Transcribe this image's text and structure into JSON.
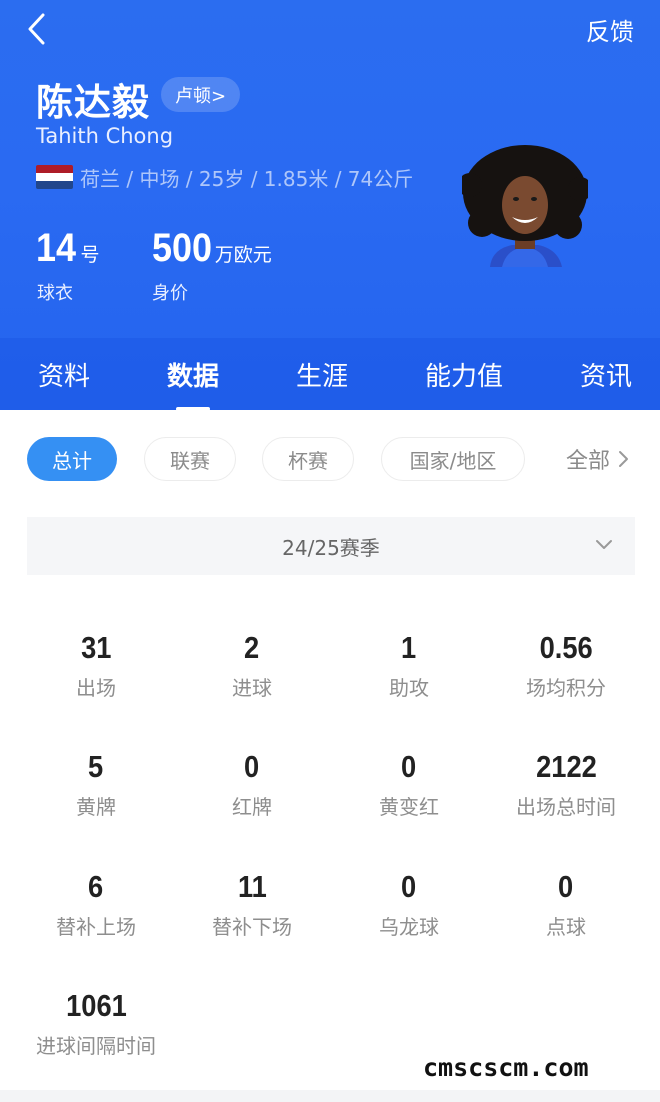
{
  "header": {
    "feedback_label": "反馈",
    "player_name": "陈达毅",
    "club_label": "卢顿>",
    "english_name": "Tahith Chong",
    "info_line": "荷兰 / 中场 / 25岁 / 1.85米 / 74公斤",
    "flag_colors": [
      "#ae1c28",
      "#ffffff",
      "#21468b"
    ],
    "jersey": {
      "value": "14",
      "unit": "号",
      "caption": "球衣"
    },
    "market_value": {
      "value": "500",
      "unit": "万欧元",
      "caption": "身价"
    }
  },
  "tabs": [
    {
      "label": "资料",
      "active": false
    },
    {
      "label": "数据",
      "active": true
    },
    {
      "label": "生涯",
      "active": false
    },
    {
      "label": "能力值",
      "active": false
    },
    {
      "label": "资讯",
      "active": false
    }
  ],
  "filters": {
    "chips": [
      "总计",
      "联赛",
      "杯赛",
      "国家/地区"
    ],
    "selected": "总计",
    "all_label": "全部"
  },
  "season": {
    "selected": "24/25赛季"
  },
  "stats": [
    {
      "value": "31",
      "label": "出场"
    },
    {
      "value": "2",
      "label": "进球"
    },
    {
      "value": "1",
      "label": "助攻"
    },
    {
      "value": "0.56",
      "label": "场均积分"
    },
    {
      "value": "5",
      "label": "黄牌"
    },
    {
      "value": "0",
      "label": "红牌"
    },
    {
      "value": "0",
      "label": "黄变红"
    },
    {
      "value": "2122",
      "label": "出场总时间"
    },
    {
      "value": "6",
      "label": "替补上场"
    },
    {
      "value": "11",
      "label": "替补下场"
    },
    {
      "value": "0",
      "label": "乌龙球"
    },
    {
      "value": "0",
      "label": "点球"
    },
    {
      "value": "1061",
      "label": "进球间隔时间"
    }
  ],
  "watermark": "cmscscm.com",
  "colors": {
    "header_blue": "#2a6af2",
    "chip_active": "#3590f3"
  },
  "icons": {
    "back": "chevron-left-icon",
    "all": "chevron-right-icon",
    "season": "chevron-down-icon"
  }
}
